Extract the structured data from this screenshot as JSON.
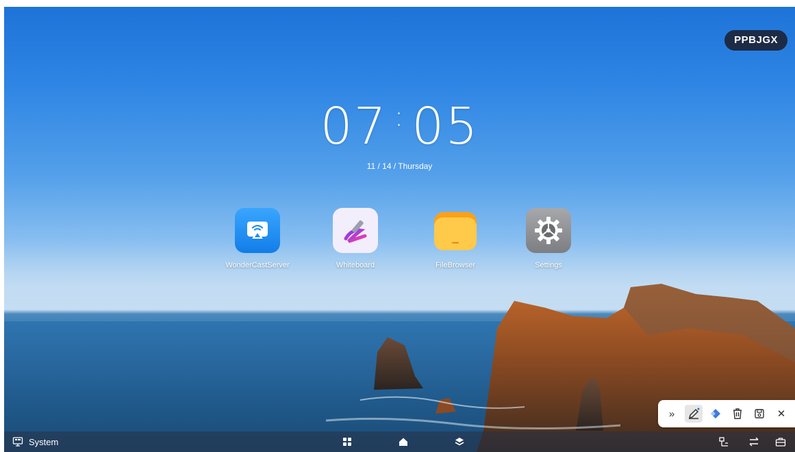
{
  "device": {
    "name": "PPBJGX"
  },
  "clock": {
    "hours": "07",
    "minutes": "05",
    "date": "11 / 14 / Thursday"
  },
  "apps": [
    {
      "label": "WonderCastServer",
      "icon": "cast-icon",
      "color": "#1e90f5"
    },
    {
      "label": "Whiteboard",
      "icon": "pen-icon",
      "color": "#f3eefb"
    },
    {
      "label": "FileBrowser",
      "icon": "folder-icon",
      "color": "#ffb52e"
    },
    {
      "label": "Settings",
      "icon": "gear-icon",
      "color": "#8e8f93"
    }
  ],
  "taskbar": {
    "system_label": "System"
  },
  "annotation_toolbar": {
    "tools": [
      "expand-icon",
      "pen-icon",
      "eraser-icon",
      "trash-icon",
      "save-icon",
      "close-icon"
    ],
    "expand_glyph": "»",
    "close_glyph": "✕"
  }
}
